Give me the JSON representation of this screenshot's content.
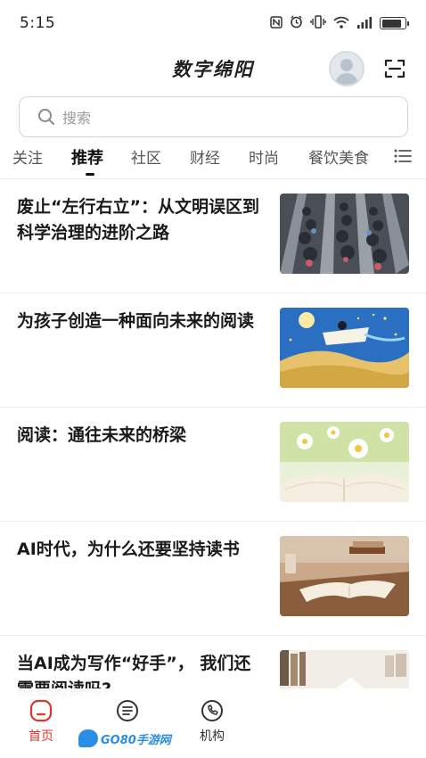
{
  "status_bar": {
    "time": "5:15",
    "icons": [
      "nfc-icon",
      "alarm-icon",
      "vibrate-icon",
      "wifi-icon",
      "signal-icon",
      "battery-icon"
    ],
    "battery_level": 0.85
  },
  "header": {
    "title": "数字绵阳"
  },
  "search": {
    "placeholder": "搜索"
  },
  "tabs": [
    "关注",
    "推荐",
    "社区",
    "财经",
    "时尚",
    "餐饮美食"
  ],
  "active_tab": "推荐",
  "articles": [
    {
      "title": "废止“左行右立”：从文明误区到科学治理的进阶之路",
      "image": "escalator-crowd"
    },
    {
      "title": "为孩子创造一种面向未来的阅读",
      "image": "child-reading-on-book-in-sky"
    },
    {
      "title": "阅读：通往未来的桥梁",
      "image": "open-book-with-daisies"
    },
    {
      "title": "AI时代，为什么还要坚持读书",
      "image": "book-on-wooden-desk"
    },
    {
      "title": "当AI成为写作“好手”， 我们还需要阅读吗?",
      "image": "faded-bookshelf"
    }
  ],
  "bottom_nav": [
    {
      "label": "首页",
      "icon": "home-icon",
      "active": true
    },
    {
      "label": "",
      "icon": "list-icon",
      "active": false
    },
    {
      "label": "机构",
      "icon": "phone-icon",
      "active": false
    }
  ],
  "watermark": {
    "text": "GO80手游网"
  },
  "colors": {
    "accent": "#d8372c",
    "text": "#1a1a1a",
    "muted": "#9a9a9a"
  }
}
